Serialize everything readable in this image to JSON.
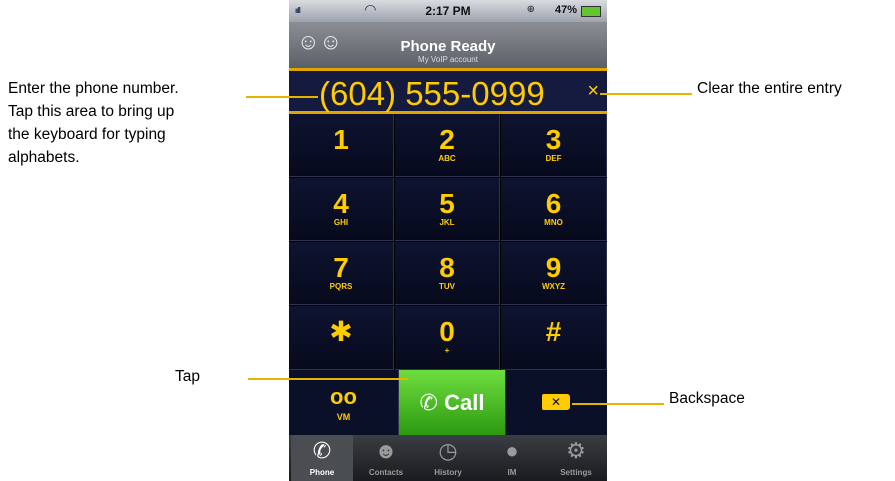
{
  "status_bar": {
    "signal": "ııll",
    "time": "2:17 PM",
    "lock": "⊕",
    "battery_percent": "47%"
  },
  "header": {
    "title": "Phone Ready",
    "subtitle": "My VoIP account"
  },
  "display": {
    "number": "(604) 555-0999",
    "clear_glyph": "×"
  },
  "keys": [
    {
      "digit": "1",
      "letters": ""
    },
    {
      "digit": "2",
      "letters": "ABC"
    },
    {
      "digit": "3",
      "letters": "DEF"
    },
    {
      "digit": "4",
      "letters": "GHI"
    },
    {
      "digit": "5",
      "letters": "JKL"
    },
    {
      "digit": "6",
      "letters": "MNO"
    },
    {
      "digit": "7",
      "letters": "PQRS"
    },
    {
      "digit": "8",
      "letters": "TUV"
    },
    {
      "digit": "9",
      "letters": "WXYZ"
    },
    {
      "digit": "✱",
      "letters": ""
    },
    {
      "digit": "0",
      "letters": "+"
    },
    {
      "digit": "#",
      "letters": ""
    }
  ],
  "actions": {
    "voicemail_label": "VM",
    "call_label": "Call",
    "backspace_glyph": "✕"
  },
  "tabs": [
    {
      "label": "Phone",
      "icon": "phone-icon"
    },
    {
      "label": "Contacts",
      "icon": "contacts-icon"
    },
    {
      "label": "History",
      "icon": "clock-icon"
    },
    {
      "label": "IM",
      "icon": "chat-bubble-icon"
    },
    {
      "label": "Settings",
      "icon": "gears-icon"
    }
  ],
  "annotations": {
    "enter_number": [
      "Enter the phone number.",
      "Tap this area to bring up",
      "the keyboard for typing",
      "alphabets."
    ],
    "clear_entry": "Clear the entire entry",
    "tap": "Tap",
    "backspace": "Backspace"
  },
  "colors": {
    "accent": "#ffcc00",
    "call_green": "#3aa81c",
    "annotation_line": "#e4b400"
  }
}
